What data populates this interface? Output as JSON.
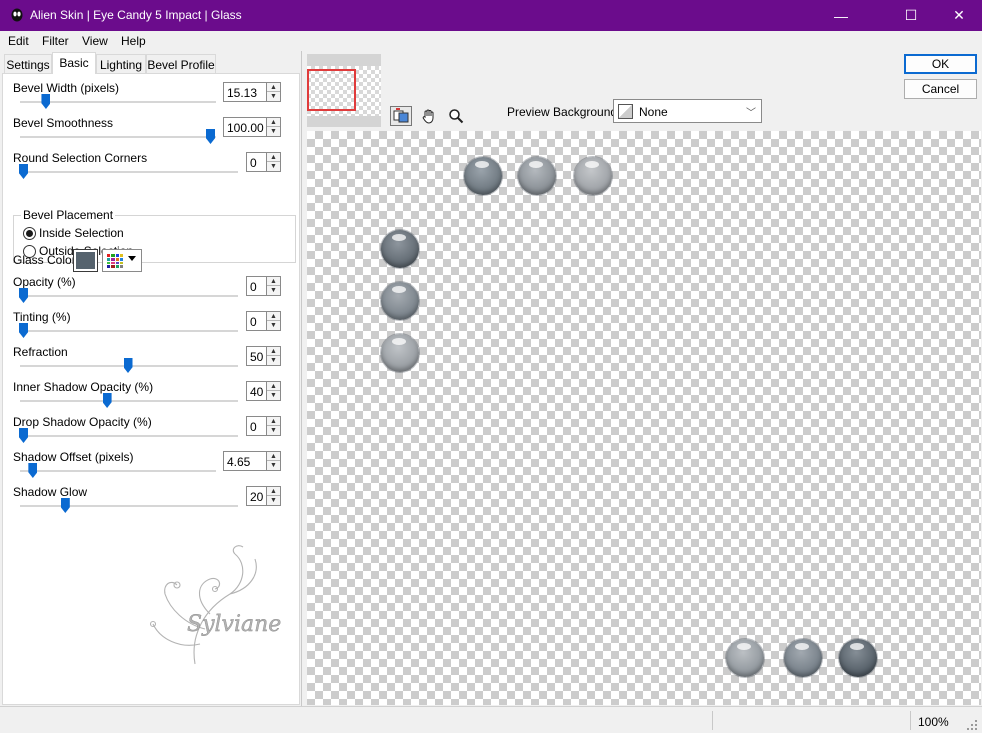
{
  "window": {
    "title": "Alien Skin | Eye Candy 5 Impact | Glass",
    "minimize": "—",
    "maximize": "☐",
    "close": "✕"
  },
  "menu": [
    {
      "label": "Edit"
    },
    {
      "label": "Filter"
    },
    {
      "label": "View"
    },
    {
      "label": "Help"
    }
  ],
  "tabs": [
    "Settings",
    "Basic",
    "Lighting",
    "Bevel Profile"
  ],
  "active_tab": "Basic",
  "params": {
    "bevel_width": {
      "label": "Bevel Width (pixels)",
      "value": "15.13",
      "fraction": 0.12
    },
    "bevel_smoothness": {
      "label": "Bevel Smoothness",
      "value": "100.00",
      "fraction": 1.0
    },
    "round_corners": {
      "label": "Round Selection Corners",
      "value": "0",
      "fraction": 0.0
    },
    "opacity": {
      "label": "Opacity (%)",
      "value": "0",
      "fraction": 0.0
    },
    "tinting": {
      "label": "Tinting (%)",
      "value": "0",
      "fraction": 0.0
    },
    "refraction": {
      "label": "Refraction",
      "value": "50",
      "fraction": 0.5
    },
    "inner_shadow": {
      "label": "Inner Shadow Opacity (%)",
      "value": "40",
      "fraction": 0.4
    },
    "drop_shadow": {
      "label": "Drop Shadow Opacity (%)",
      "value": "0",
      "fraction": 0.0
    },
    "shadow_offset": {
      "label": "Shadow Offset (pixels)",
      "value": "4.65",
      "fraction": 0.05
    },
    "shadow_glow": {
      "label": "Shadow Glow",
      "value": "20",
      "fraction": 0.2
    }
  },
  "bevel_placement": {
    "legend": "Bevel Placement",
    "inside": "Inside Selection",
    "outside": "Outside Selection",
    "selected": "inside"
  },
  "glass_color": {
    "label": "Glass Color",
    "value": "#56636e"
  },
  "watermark_text": "Sylviane",
  "preview": {
    "background_label": "Preview Background:",
    "background_value": "None"
  },
  "buttons": {
    "ok": "OK",
    "cancel": "Cancel"
  },
  "status": {
    "zoom": "100%"
  },
  "colors": {
    "titlebar": "#6b0c8c",
    "accent": "#0b6ad1"
  }
}
